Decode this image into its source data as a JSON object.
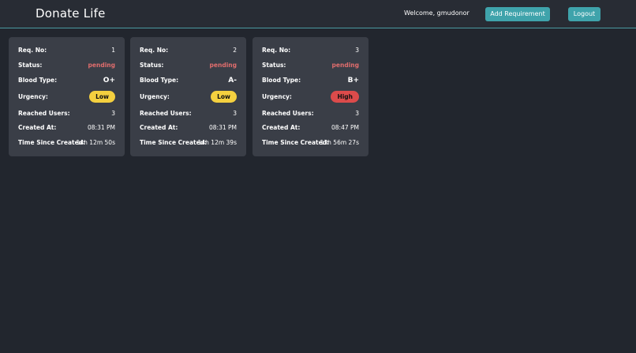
{
  "header": {
    "title": "Donate Life",
    "welcome": "Welcome, gmudonor",
    "add_button": "Add Requirement",
    "logout_button": "Logout"
  },
  "labels": {
    "req_no": "Req. No:",
    "status": "Status:",
    "blood_type": "Blood Type:",
    "urgency": "Urgency:",
    "reached_users": "Reached Users:",
    "created_at": "Created At:",
    "time_since": "Time Since Created:"
  },
  "colors": {
    "accent": "#3fa3ab",
    "status_pending": "#e06d6d",
    "urgency_low": "#f4d03f",
    "urgency_high": "#dc4b4b"
  },
  "cards": [
    {
      "req_no": "1",
      "status": "pending",
      "blood_type": "O+",
      "urgency": "Low",
      "reached_users": "3",
      "created_at": "08:31 PM",
      "time_since": "14h 12m 50s"
    },
    {
      "req_no": "2",
      "status": "pending",
      "blood_type": "A-",
      "urgency": "Low",
      "reached_users": "3",
      "created_at": "08:31 PM",
      "time_since": "14h 12m 39s"
    },
    {
      "req_no": "3",
      "status": "pending",
      "blood_type": "B+",
      "urgency": "High",
      "reached_users": "3",
      "created_at": "08:47 PM",
      "time_since": "13h 56m 27s"
    }
  ]
}
